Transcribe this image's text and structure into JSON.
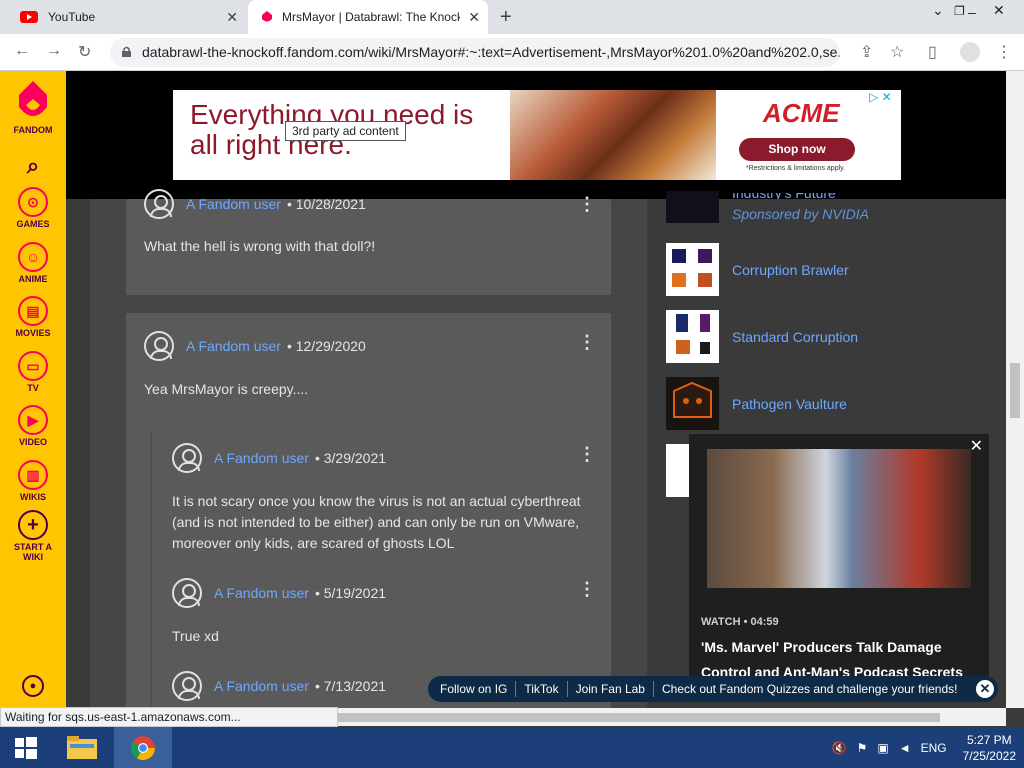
{
  "browser": {
    "tabs": [
      {
        "title": "YouTube",
        "active": false
      },
      {
        "title": "MrsMayor | Databrawl: The Knockoff",
        "active": true
      }
    ],
    "url": "databrawl-the-knockoff.fandom.com/wiki/MrsMayor#:~:text=Advertisement-,MrsMayor%201.0%20and%202.0,se...",
    "status_text": "Waiting for sqs.us-east-1.amazonaws.com..."
  },
  "sidebar": {
    "logo_label": "FANDOM",
    "items": [
      {
        "label": "GAMES",
        "icon": "gamepad-icon"
      },
      {
        "label": "ANIME",
        "icon": "anime-face-icon"
      },
      {
        "label": "MOVIES",
        "icon": "film-icon"
      },
      {
        "label": "TV",
        "icon": "tv-icon"
      },
      {
        "label": "VIDEO",
        "icon": "play-icon"
      },
      {
        "label": "WIKIS",
        "icon": "book-icon"
      },
      {
        "label": "START A WIKI",
        "icon": "plus-icon"
      }
    ]
  },
  "ad": {
    "headline": "Everything you need is all right here.",
    "brand": "ACME",
    "cta": "Shop now",
    "fine_print": "*Restrictions & limitations apply.",
    "tooltip": "3rd party ad content"
  },
  "comments": [
    {
      "user": "A Fandom user",
      "date": "10/28/2021",
      "text": "What the hell is wrong with that doll?!"
    },
    {
      "user": "A Fandom user",
      "date": "12/29/2020",
      "text": "Yea MrsMayor is creepy...."
    },
    {
      "user": "A Fandom user",
      "date": "3/29/2021",
      "text": "It is not scary once you know the virus is not an actual cyberthreat (and is not intended to be either) and can only be run on VMware, moreover only kids, are scared of ghosts LOL"
    },
    {
      "user": "A Fandom user",
      "date": "5/19/2021",
      "text": "True xd"
    },
    {
      "user": "A Fandom user",
      "date": "7/13/2021",
      "text": ""
    }
  ],
  "rail": {
    "sponsored_title": "Industry's Future",
    "sponsored_by": "Sponsored by NVIDIA",
    "links": [
      "Corruption Brawler",
      "Standard Corruption",
      "Pathogen Vaulture"
    ]
  },
  "video": {
    "watch": "WATCH • 04:59",
    "title": "'Ms. Marvel' Producers Talk Damage Control and Ant-Man's Podcast Secrets"
  },
  "promo": {
    "items": [
      "Follow on IG",
      "TikTok",
      "Join Fan Lab",
      "Check out Fandom Quizzes and challenge your friends!"
    ]
  },
  "taskbar": {
    "lang": "ENG",
    "time": "5:27 PM",
    "date": "7/25/2022"
  }
}
